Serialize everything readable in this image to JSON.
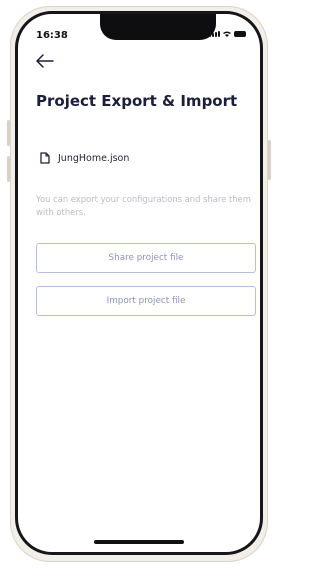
{
  "status_bar": {
    "time": "16:38"
  },
  "header": {
    "back_icon": "arrow-left-icon",
    "title": "Project Export & Import"
  },
  "file": {
    "icon": "file-icon",
    "name": "JungHome.json"
  },
  "description": "You can export your configurations and share them with others.",
  "buttons": {
    "share_label": "Share project file",
    "import_label": "Import project file"
  },
  "colors": {
    "title": "#1b1f3a",
    "button_border": "#b7bfdf",
    "button_text": "#8d93b8",
    "description": "#b9bcc6"
  }
}
